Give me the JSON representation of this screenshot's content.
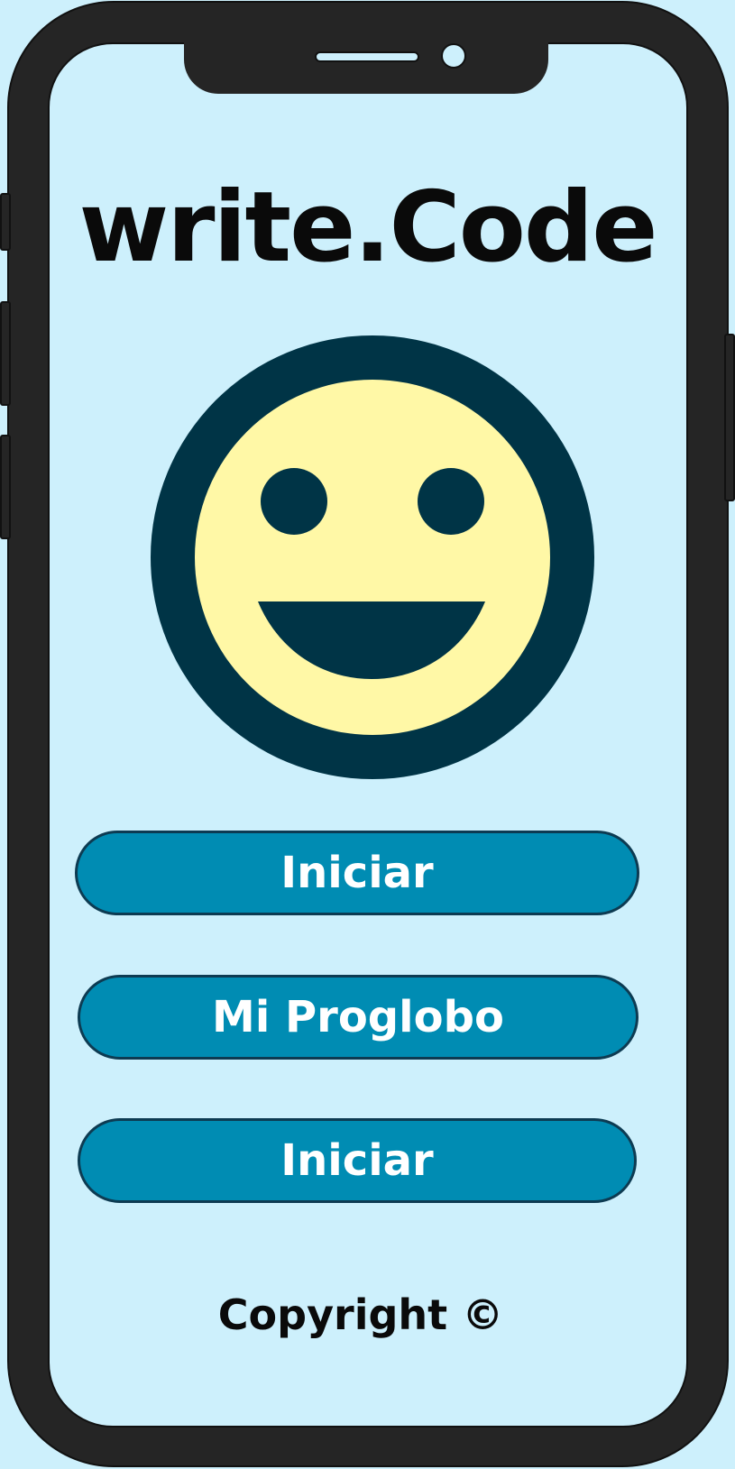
{
  "app": {
    "title": "write.Code"
  },
  "menu": {
    "buttons": [
      {
        "label": "Iniciar"
      },
      {
        "label": "Mi Proglobo"
      },
      {
        "label": "Iniciar"
      }
    ]
  },
  "footer": {
    "copyright": "Copyright ©"
  },
  "avatar": {
    "icon": "smiley-face-icon"
  },
  "colors": {
    "background": "#cdf0fc",
    "phone_frame": "#252525",
    "face_fill": "#fff8a6",
    "face_outline": "#003446",
    "button_fill": "#008cb3",
    "button_border": "#0d3b52",
    "button_text": "#ffffff"
  }
}
